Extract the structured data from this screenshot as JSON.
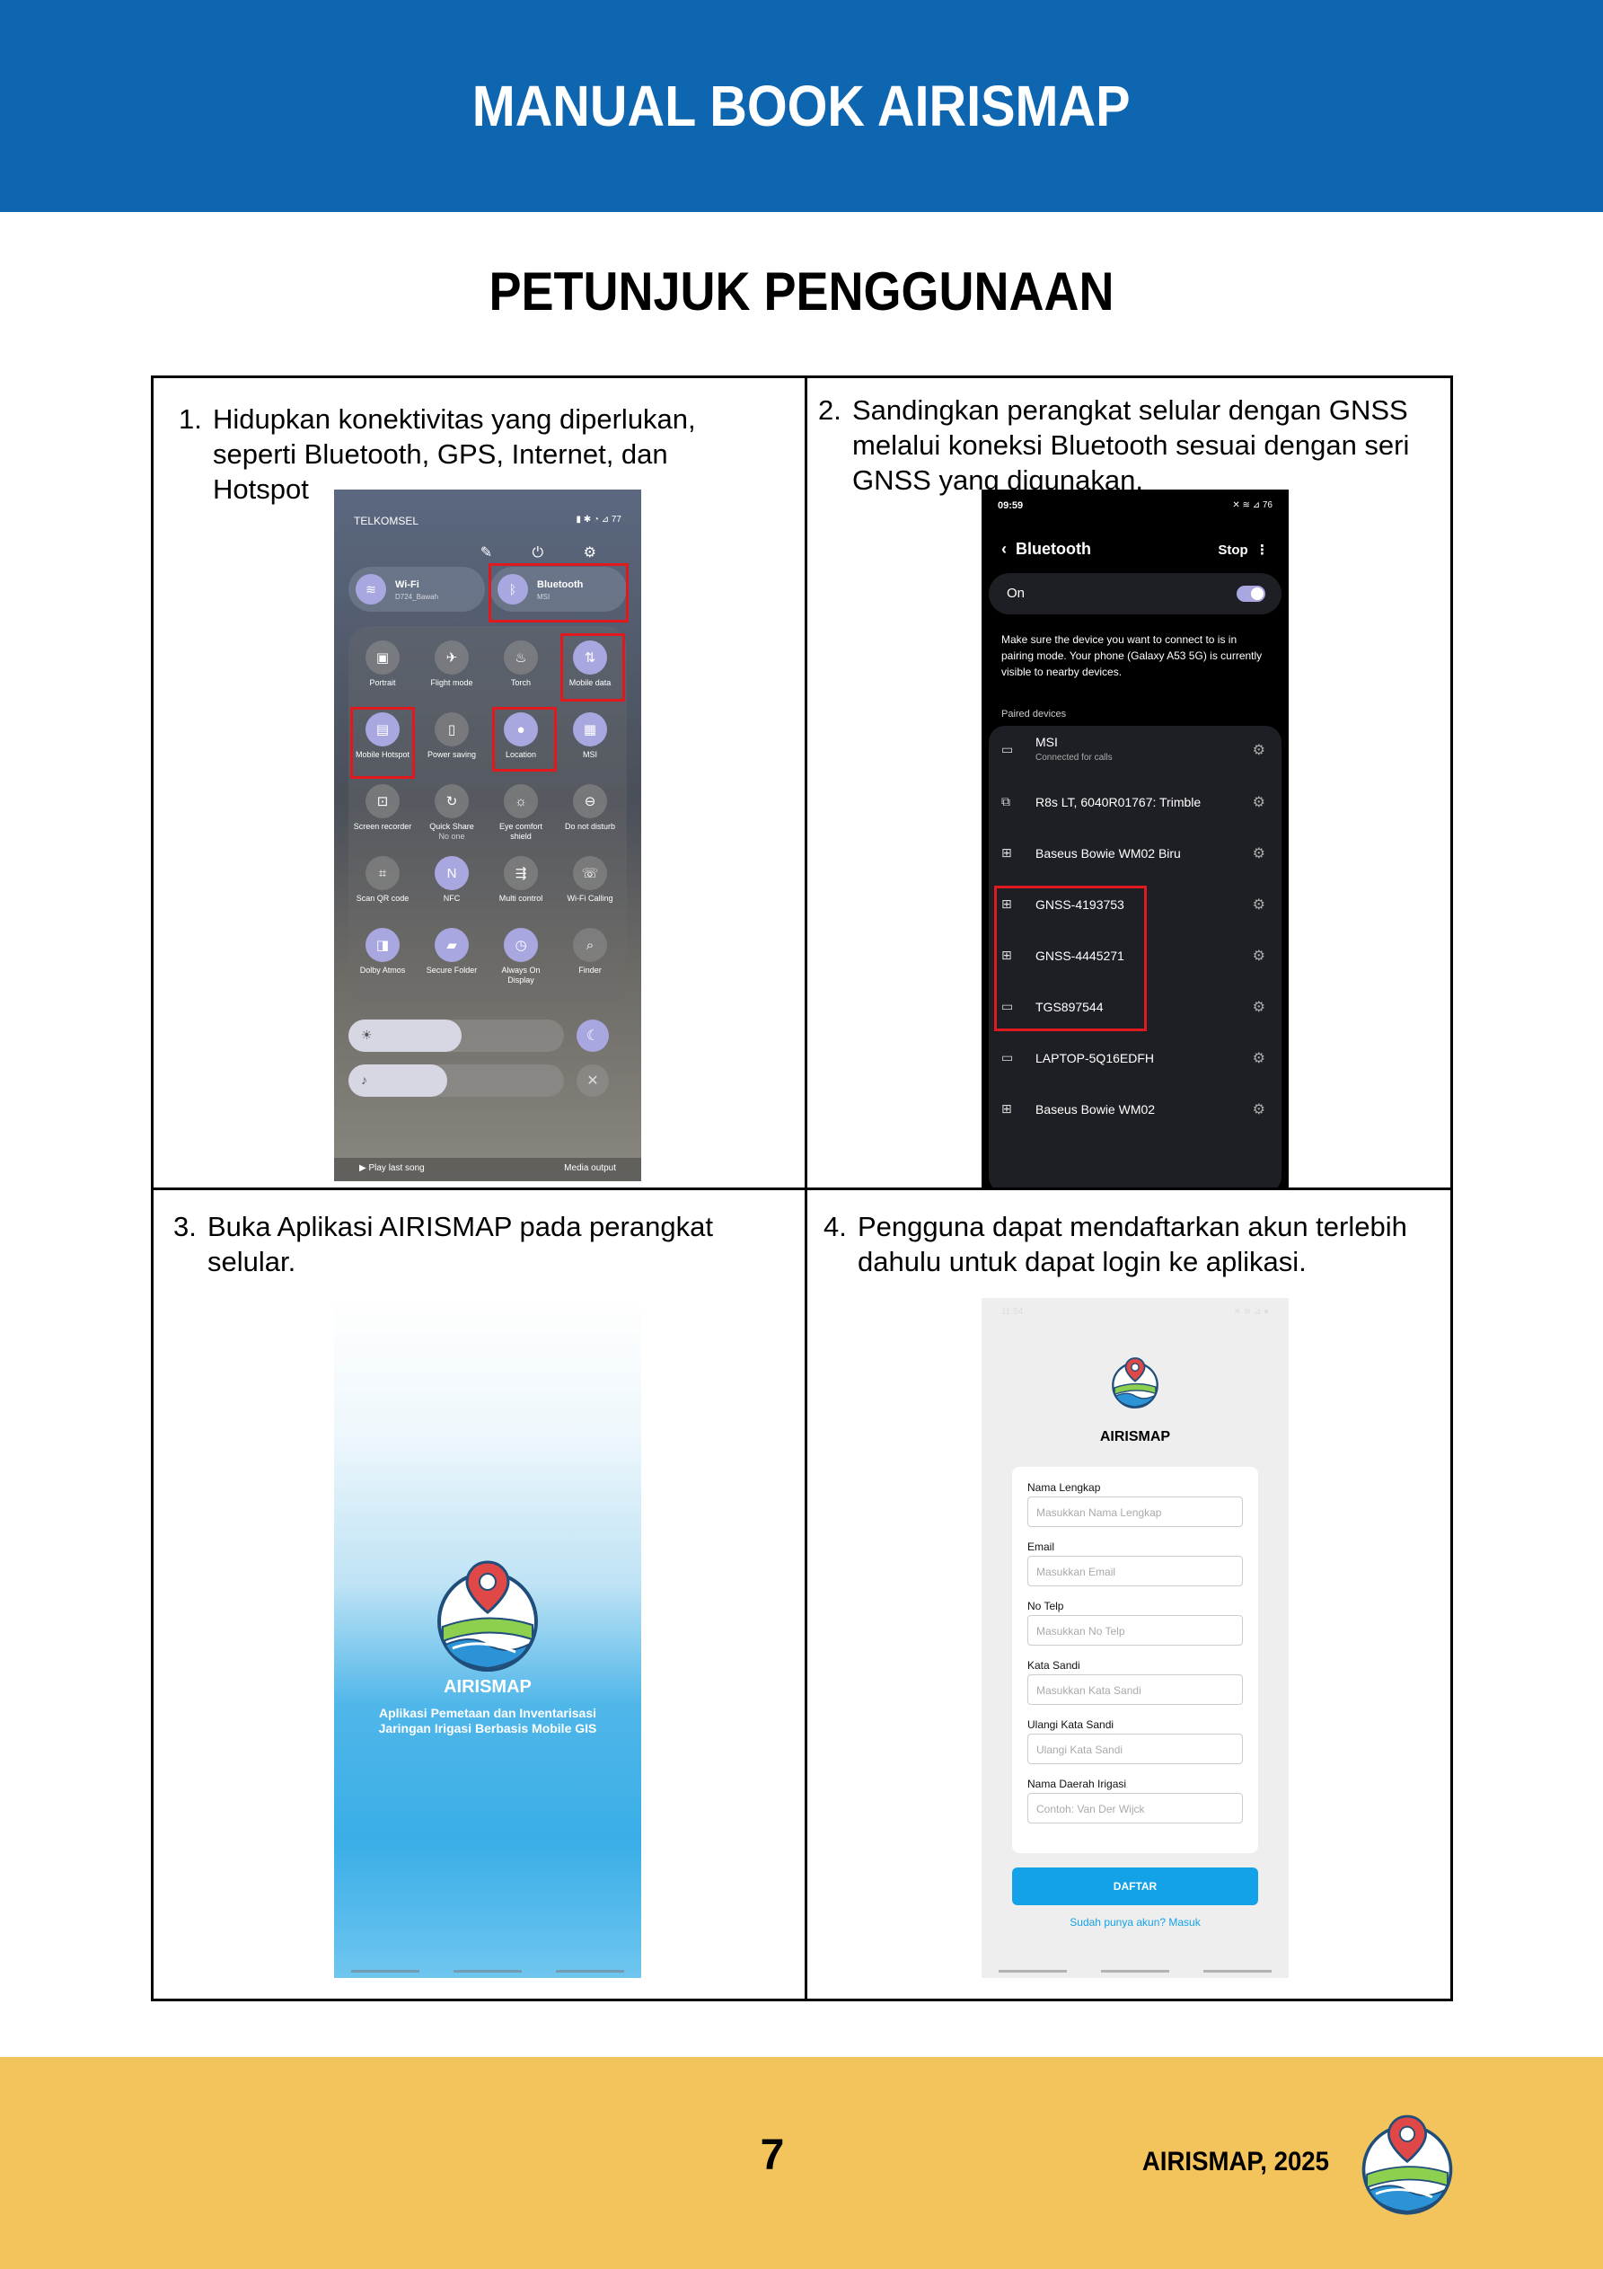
{
  "header": {
    "title": "MANUAL BOOK AIRISMAP"
  },
  "section_title": "PETUNJUK PENGGUNAAN",
  "steps": [
    {
      "num": "1.",
      "text": "Hidupkan konektivitas yang diperlukan, seperti Bluetooth, GPS, Internet, dan Hotspot"
    },
    {
      "num": "2.",
      "text": "Sandingkan perangkat selular dengan GNSS melalui koneksi Bluetooth sesuai dengan seri GNSS yang digunakan."
    },
    {
      "num": "3.",
      "text": "Buka Aplikasi AIRISMAP pada perangkat selular."
    },
    {
      "num": "4.",
      "text": "Pengguna dapat mendaftarkan akun terlebih dahulu untuk dapat login ke aplikasi."
    }
  ],
  "phone1": {
    "carrier": "TELKOMSEL",
    "wifi": {
      "label": "Wi-Fi",
      "sub": "D724_Bawah"
    },
    "bluetooth": {
      "label": "Bluetooth",
      "sub": "MSI"
    },
    "tiles": [
      {
        "label": "Portrait",
        "icon": "portrait-icon"
      },
      {
        "label": "Flight mode",
        "icon": "airplane-icon"
      },
      {
        "label": "Torch",
        "icon": "torch-icon"
      },
      {
        "label": "Mobile data",
        "icon": "mobile-data-icon"
      },
      {
        "label": "Mobile Hotspot",
        "icon": "hotspot-icon"
      },
      {
        "label": "Power saving",
        "icon": "battery-icon"
      },
      {
        "label": "Location",
        "icon": "location-icon"
      },
      {
        "label": "MSI",
        "icon": "device-icon"
      },
      {
        "label": "Screen recorder",
        "icon": "screen-recorder-icon"
      },
      {
        "label": "Quick Share",
        "sub": "No one",
        "icon": "quick-share-icon"
      },
      {
        "label": "Eye comfort shield",
        "icon": "eye-comfort-icon"
      },
      {
        "label": "Do not disturb",
        "icon": "dnd-icon"
      },
      {
        "label": "Scan QR code",
        "icon": "qr-icon"
      },
      {
        "label": "NFC",
        "icon": "nfc-icon"
      },
      {
        "label": "Multi control",
        "icon": "multi-control-icon"
      },
      {
        "label": "Wi-Fi Calling",
        "icon": "wifi-calling-icon"
      },
      {
        "label": "Dolby Atmos",
        "icon": "dolby-icon"
      },
      {
        "label": "Secure Folder",
        "icon": "secure-folder-icon"
      },
      {
        "label": "Always On Display",
        "icon": "aod-icon"
      },
      {
        "label": "Finder",
        "icon": "search-icon"
      }
    ],
    "play_last_song": "▶ Play last song",
    "media_output": "Media output"
  },
  "phone2": {
    "time": "09:59",
    "battery": "76",
    "title": "Bluetooth",
    "stop": "Stop",
    "on_label": "On",
    "message": "Make sure the device you want to connect to is in pairing mode. Your phone (Galaxy A53 5G) is currently visible to nearby devices.",
    "paired_label": "Paired devices",
    "devices": [
      {
        "name": "MSI",
        "sub": "Connected for calls",
        "icon": "laptop-icon"
      },
      {
        "name": "R8s LT, 6040R01767: Trimble",
        "sub": "",
        "icon": "devices-icon"
      },
      {
        "name": "Baseus Bowie WM02 Biru",
        "sub": "",
        "icon": "apps-icon"
      },
      {
        "name": "GNSS-4193753",
        "sub": "",
        "icon": "apps-icon"
      },
      {
        "name": "GNSS-4445271",
        "sub": "",
        "icon": "apps-icon"
      },
      {
        "name": "TGS897544",
        "sub": "",
        "icon": "laptop-icon"
      },
      {
        "name": "LAPTOP-5Q16EDFH",
        "sub": "",
        "icon": "laptop-icon"
      },
      {
        "name": "Baseus Bowie WM02",
        "sub": "",
        "icon": "apps-icon"
      }
    ]
  },
  "phone3": {
    "title": "AIRISMAP",
    "subtitle": "Aplikasi Pemetaan dan Inventarisasi Jaringan Irigasi Berbasis Mobile GIS"
  },
  "phone4": {
    "time": "11:54",
    "app_name": "AIRISMAP",
    "fields": [
      {
        "label": "Nama Lengkap",
        "placeholder": "Masukkan Nama Lengkap"
      },
      {
        "label": "Email",
        "placeholder": "Masukkan Email"
      },
      {
        "label": "No Telp",
        "placeholder": "Masukkan No Telp"
      },
      {
        "label": "Kata Sandi",
        "placeholder": "Masukkan Kata Sandi"
      },
      {
        "label": "Ulangi Kata Sandi",
        "placeholder": "Ulangi Kata Sandi"
      },
      {
        "label": "Nama Daerah Irigasi",
        "placeholder": "Contoh: Van Der Wijck"
      }
    ],
    "button": "DAFTAR",
    "login_link": "Sudah punya akun? Masuk"
  },
  "footer": {
    "page_number": "7",
    "brand": "AIRISMAP, 2025"
  },
  "colors": {
    "header": "#0f66b0",
    "footer": "#f4c45c",
    "highlight": "#e0191f",
    "accent": "#13a2e7"
  }
}
